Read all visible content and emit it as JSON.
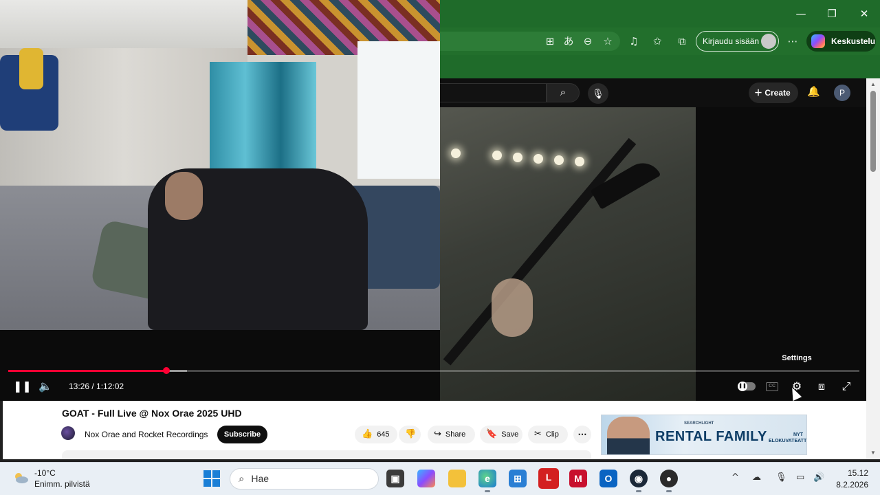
{
  "browser": {
    "signin_label": "Kirjaudu sisään",
    "copilot_label": "Keskustelu",
    "window_controls": {
      "minimize": "—",
      "restore": "❐",
      "close": "✕"
    }
  },
  "youtube_header": {
    "create_label": "Create",
    "avatar_letter": "P"
  },
  "player": {
    "time_label": "13:26 / 1:12:02",
    "progress": 0.186,
    "buffered": 0.21,
    "tooltip": "Settings"
  },
  "video": {
    "title": "GOAT - Full Live @ Nox Orae 2025 UHD",
    "channel": "Nox Orae and Rocket Recordings",
    "subscribe_label": "Subscribe",
    "like_count": "645",
    "share_label": "Share",
    "save_label": "Save",
    "clip_label": "Clip"
  },
  "ad": {
    "brand": "SEARCHLIGHT",
    "title": "RENTAL FAMILY",
    "tagline_1": "NYT",
    "tagline_2": "ELOKUVATEATTEREISSA"
  },
  "taskbar": {
    "temperature": "-10°C",
    "weather_desc": "Enimm. pilvistä",
    "search_placeholder": "Hae",
    "time": "15.12",
    "date": "8.2.2026",
    "apps": [
      "file-explorer",
      "copilot",
      "folders",
      "edge",
      "microsoft-store",
      "lastpass",
      "mcafee",
      "outlook",
      "steam",
      "obs"
    ]
  }
}
